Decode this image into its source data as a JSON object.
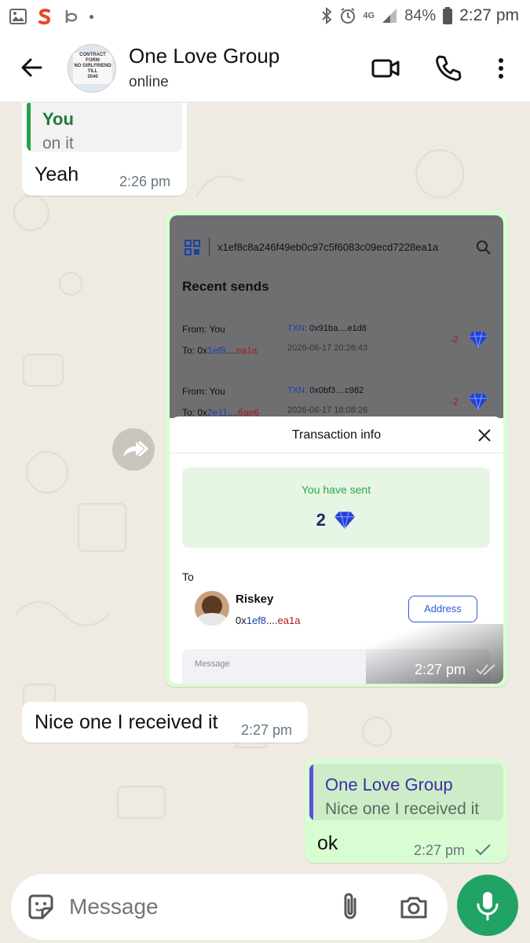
{
  "status_bar": {
    "network": "4G",
    "battery": "84%",
    "time": "2:27 pm"
  },
  "header": {
    "title": "One Love Group",
    "subtitle": "online",
    "avatar_text": "CONTRACT FORM NO GIRLFRIEND TILL 2040"
  },
  "messages": {
    "m1": {
      "quote_author": "You",
      "quote_text": "on it",
      "text": "Yeah",
      "time": "2:26 pm"
    },
    "m2": {
      "time": "2:27 pm",
      "shot": {
        "search_value": "x1ef8c8a246f49eb0c97c5f6083c09ecd7228ea1a",
        "recent_title": "Recent sends",
        "rows": [
          {
            "from": "From: You",
            "to_prefix": "To: 0x",
            "to_mid": "1ef8",
            "to_dots": "....",
            "to_end": "ea1a",
            "txn_label": "TXN:",
            "txn": "0x91ba....e1d8",
            "date": "2026-06-17 20:26:43",
            "amount": "-2"
          },
          {
            "from": "From: You",
            "to_prefix": "To: 0x",
            "to_mid": "2e11",
            "to_dots": "....",
            "to_end": "6ae6",
            "txn_label": "TXN:",
            "txn": "0x0bf3....c982",
            "date": "2026-06-17 18:08:26",
            "amount": "-2"
          }
        ],
        "modal_title": "Transaction info",
        "sent_label": "You have sent",
        "sent_amount": "2",
        "to_label": "To",
        "recipient_name": "Riskey",
        "recipient_prefix": "0x",
        "recipient_mid": "1ef8",
        "recipient_dots": "....",
        "recipient_end": "ea1a",
        "address_button": "Address",
        "message_placeholder": "Message"
      }
    },
    "m3": {
      "text": "Nice one I received it",
      "time": "2:27 pm"
    },
    "m4": {
      "quote_author": "One Love Group",
      "quote_text": "Nice one I received it",
      "text": "ok",
      "time": "2:27 pm"
    }
  },
  "composer": {
    "placeholder": "Message"
  },
  "colors": {
    "accent_green": "#21a366",
    "outgoing_bubble": "#d9fdd3",
    "chat_bg": "#efeae2",
    "quote_you_bar": "#25a244",
    "quote_group_bar": "#5b4fd8",
    "diamond_blue": "#2340d8"
  }
}
